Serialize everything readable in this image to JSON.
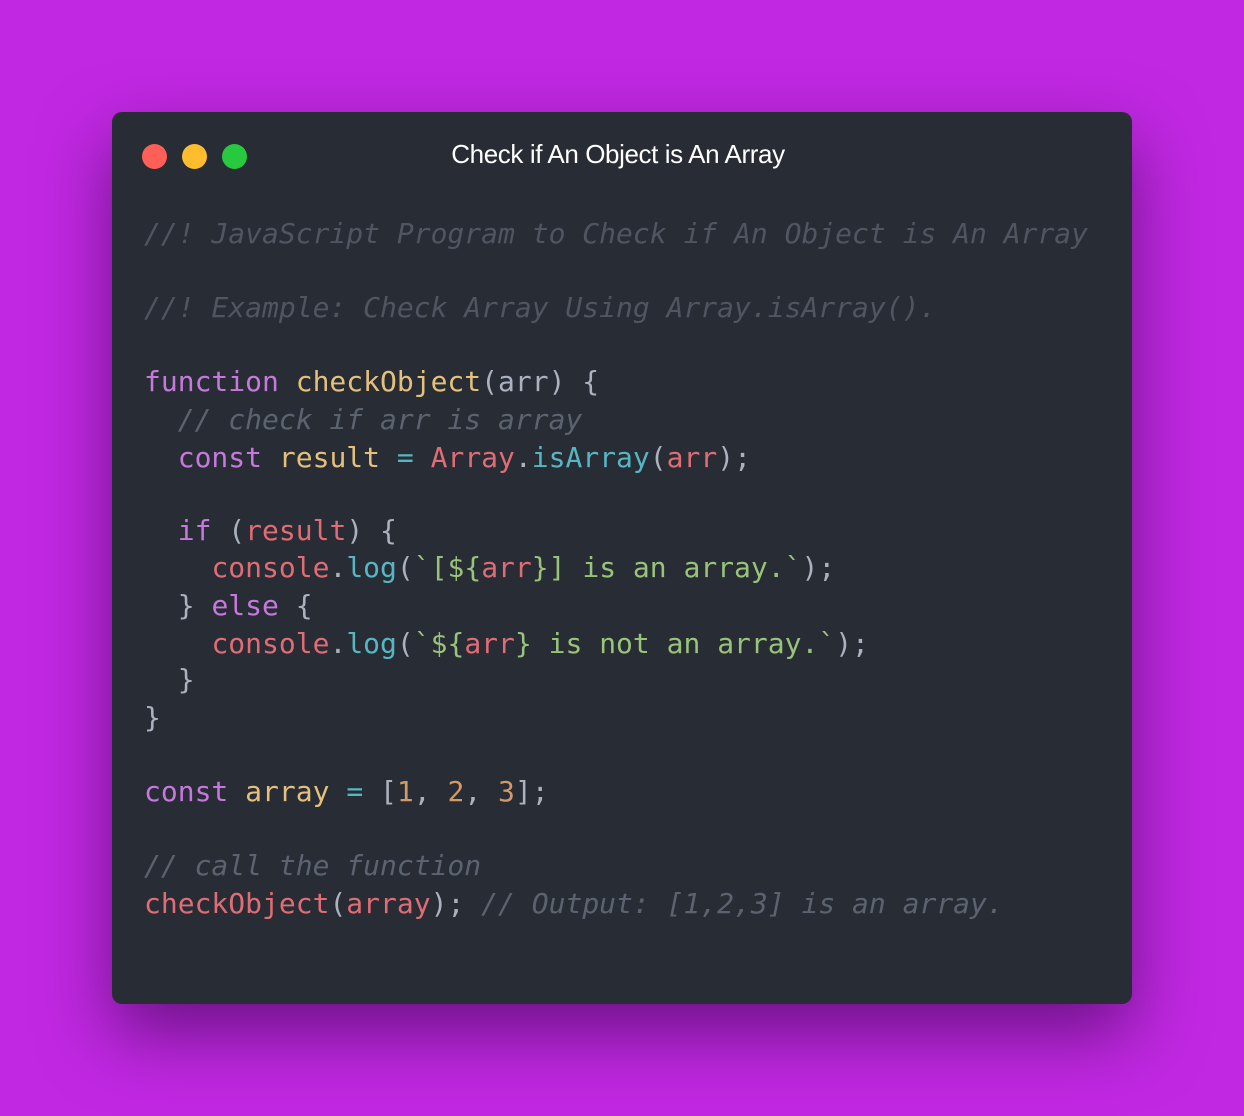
{
  "window": {
    "title": "Check if An Object is An Array",
    "controls": [
      {
        "name": "close",
        "color": "#ff5f56"
      },
      {
        "name": "minimize",
        "color": "#ffbd2e"
      },
      {
        "name": "maximize",
        "color": "#27c93f"
      }
    ],
    "background": "#c128e2",
    "editor_background": "#282c34"
  },
  "code": {
    "language": "JavaScript",
    "lines": [
      [
        {
          "t": "//! JavaScript Program to Check if An Object is An Array",
          "c": "italic-comment"
        }
      ],
      [
        {
          "t": "//! Example: Check Array Using Array.isArray().",
          "c": "italic-comment"
        }
      ],
      [
        {
          "t": "function",
          "c": "keyword"
        },
        {
          "t": " ",
          "c": "plain"
        },
        {
          "t": "checkObject",
          "c": "fn"
        },
        {
          "t": "(",
          "c": "plain"
        },
        {
          "t": "arr",
          "c": "plain"
        },
        {
          "t": ") {",
          "c": "plain"
        }
      ],
      [
        {
          "t": "  // check if arr is array",
          "c": "comment"
        }
      ],
      [
        {
          "t": "  ",
          "c": "plain"
        },
        {
          "t": "const",
          "c": "keyword"
        },
        {
          "t": " ",
          "c": "plain"
        },
        {
          "t": "result",
          "c": "fn"
        },
        {
          "t": " ",
          "c": "plain"
        },
        {
          "t": "=",
          "c": "method"
        },
        {
          "t": " ",
          "c": "plain"
        },
        {
          "t": "Array",
          "c": "builtin"
        },
        {
          "t": ".",
          "c": "plain"
        },
        {
          "t": "isArray",
          "c": "method"
        },
        {
          "t": "(",
          "c": "plain"
        },
        {
          "t": "arr",
          "c": "var"
        },
        {
          "t": ");",
          "c": "plain"
        }
      ],
      [
        {
          "t": "  ",
          "c": "plain"
        },
        {
          "t": "if",
          "c": "keyword"
        },
        {
          "t": " (",
          "c": "plain"
        },
        {
          "t": "result",
          "c": "var"
        },
        {
          "t": ") {",
          "c": "plain"
        }
      ],
      [
        {
          "t": "    ",
          "c": "plain"
        },
        {
          "t": "console",
          "c": "builtin"
        },
        {
          "t": ".",
          "c": "plain"
        },
        {
          "t": "log",
          "c": "method"
        },
        {
          "t": "(",
          "c": "plain"
        },
        {
          "t": "`[",
          "c": "string"
        },
        {
          "t": "${",
          "c": "string"
        },
        {
          "t": "arr",
          "c": "var"
        },
        {
          "t": "}",
          "c": "string"
        },
        {
          "t": "] is an array.`",
          "c": "string"
        },
        {
          "t": ");",
          "c": "plain"
        }
      ],
      [
        {
          "t": "  } ",
          "c": "plain"
        },
        {
          "t": "else",
          "c": "keyword"
        },
        {
          "t": " {",
          "c": "plain"
        }
      ],
      [
        {
          "t": "    ",
          "c": "plain"
        },
        {
          "t": "console",
          "c": "builtin"
        },
        {
          "t": ".",
          "c": "plain"
        },
        {
          "t": "log",
          "c": "method"
        },
        {
          "t": "(",
          "c": "plain"
        },
        {
          "t": "`",
          "c": "string"
        },
        {
          "t": "${",
          "c": "string"
        },
        {
          "t": "arr",
          "c": "var"
        },
        {
          "t": "}",
          "c": "string"
        },
        {
          "t": " is not an array.`",
          "c": "string"
        },
        {
          "t": ");",
          "c": "plain"
        }
      ],
      [
        {
          "t": "  }",
          "c": "plain"
        }
      ],
      [
        {
          "t": "}",
          "c": "plain"
        }
      ],
      [
        {
          "t": "const",
          "c": "keyword"
        },
        {
          "t": " ",
          "c": "plain"
        },
        {
          "t": "array",
          "c": "fn"
        },
        {
          "t": " ",
          "c": "plain"
        },
        {
          "t": "=",
          "c": "method"
        },
        {
          "t": " [",
          "c": "plain"
        },
        {
          "t": "1",
          "c": "number"
        },
        {
          "t": ", ",
          "c": "plain"
        },
        {
          "t": "2",
          "c": "number"
        },
        {
          "t": ", ",
          "c": "plain"
        },
        {
          "t": "3",
          "c": "number"
        },
        {
          "t": "];",
          "c": "plain"
        }
      ],
      [
        {
          "t": "// call the function",
          "c": "comment"
        }
      ],
      [
        {
          "t": "checkObject",
          "c": "var"
        },
        {
          "t": "(",
          "c": "plain"
        },
        {
          "t": "array",
          "c": "var"
        },
        {
          "t": "); ",
          "c": "plain"
        },
        {
          "t": "// Output: [1,2,3] is an array.",
          "c": "comment"
        }
      ]
    ]
  }
}
